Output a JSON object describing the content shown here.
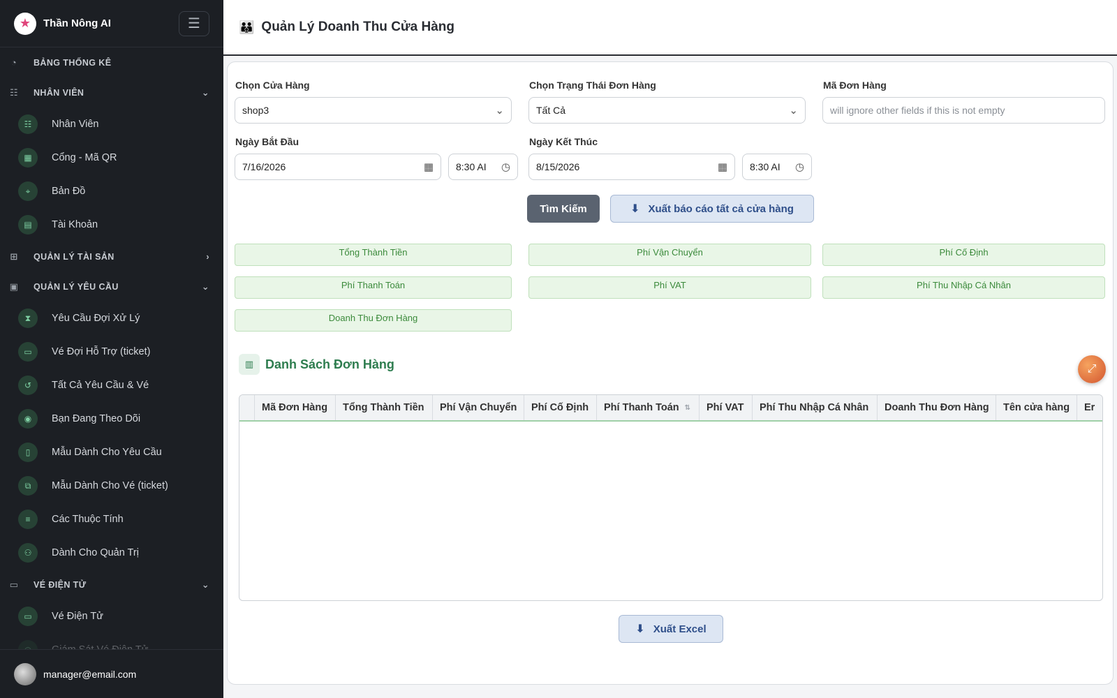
{
  "app": {
    "name": "Thần Nông AI"
  },
  "sidebar": {
    "nav": [
      {
        "type": "section",
        "label": "BẢNG THỐNG KÊ",
        "icon": "dashboard-icon",
        "glyph": "◔",
        "chevron": ""
      },
      {
        "type": "section",
        "label": "NHÂN VIÊN",
        "icon": "users-icon",
        "glyph": "☷",
        "chevron": "⌄"
      },
      {
        "type": "item",
        "label": "Nhân Viên",
        "icon": "users-icon",
        "glyph": "☷"
      },
      {
        "type": "item",
        "label": "Cổng - Mã QR",
        "icon": "qr-code-icon",
        "glyph": "▦"
      },
      {
        "type": "item",
        "label": "Bản Đồ",
        "icon": "map-icon",
        "glyph": "⌖"
      },
      {
        "type": "item",
        "label": "Tài Khoản",
        "icon": "id-card-icon",
        "glyph": "▤"
      },
      {
        "type": "section",
        "label": "QUẢN LÝ TÀI SẢN",
        "icon": "sitemap-icon",
        "glyph": "⊞",
        "chevron": "›"
      },
      {
        "type": "section",
        "label": "QUẢN LÝ YÊU CẦU",
        "icon": "clipboard-icon",
        "glyph": "▣",
        "chevron": "⌄"
      },
      {
        "type": "item",
        "label": "Yêu Cầu Đợi Xử Lý",
        "icon": "hourglass-icon",
        "glyph": "⧗"
      },
      {
        "type": "item",
        "label": "Vé Đợi Hỗ Trợ (ticket)",
        "icon": "ticket-icon",
        "glyph": "▭"
      },
      {
        "type": "item",
        "label": "Tất Cả Yêu Cầu & Vé",
        "icon": "history-icon",
        "glyph": "↺"
      },
      {
        "type": "item",
        "label": "Bạn Đang Theo Dõi",
        "icon": "eye-icon",
        "glyph": "◉"
      },
      {
        "type": "item",
        "label": "Mẫu Dành Cho Yêu Cầu",
        "icon": "file-icon",
        "glyph": "▯"
      },
      {
        "type": "item",
        "label": "Mẫu Dành Cho Vé (ticket)",
        "icon": "copy-icon",
        "glyph": "⧉"
      },
      {
        "type": "item",
        "label": "Các Thuộc Tính",
        "icon": "sliders-icon",
        "glyph": "≡"
      },
      {
        "type": "item",
        "label": "Dành Cho Quản Trị",
        "icon": "user-gear-icon",
        "glyph": "⚇"
      },
      {
        "type": "section",
        "label": "VÉ ĐIỆN TỬ",
        "icon": "ticket-icon",
        "glyph": "▭",
        "chevron": "⌄"
      },
      {
        "type": "item",
        "label": "Vé Điện Tử",
        "icon": "ticket-icon",
        "glyph": "▭"
      },
      {
        "type": "item",
        "label": "Giám Sát Vé Điện Tử",
        "icon": "monitor-icon",
        "glyph": "◎",
        "faded": true
      }
    ],
    "user_email": "manager@email.com"
  },
  "header": {
    "title": "Quản Lý Doanh Thu Cửa Hàng",
    "icon": "people-icon"
  },
  "filters": {
    "store_label": "Chọn Cửa Hàng",
    "store_value": "shop3",
    "status_label": "Chọn Trạng Thái Đơn Hàng",
    "status_value": "Tất Cả",
    "order_id_label": "Mã Đơn Hàng",
    "order_id_placeholder": "will ignore other fields if this is not empty",
    "start_label": "Ngày Bắt Đầu",
    "start_date": "7/16/2026",
    "start_time": "8:30 AI",
    "end_label": "Ngày Kết Thúc",
    "end_date": "8/15/2026",
    "end_time": "8:30 AI"
  },
  "actions": {
    "search_label": "Tìm Kiếm",
    "export_all_label": "Xuất báo cáo tất cả cửa hàng",
    "export_excel_label": "Xuất Excel"
  },
  "summary": {
    "total": "Tổng Thành Tiền",
    "shipping": "Phí Vận Chuyển",
    "fixed": "Phí Cố Định",
    "payment": "Phí Thanh Toán",
    "vat": "Phí VAT",
    "pit": "Phí Thu Nhập Cá Nhân",
    "revenue": "Doanh Thu Đơn Hàng"
  },
  "orders": {
    "title": "Danh Sách Đơn Hàng",
    "columns": [
      "Mã Đơn Hàng",
      "Tổng Thành Tiền",
      "Phí Vận Chuyển",
      "Phí Cố Định",
      "Phí Thanh Toán",
      "Phí VAT",
      "Phí Thu Nhập Cá Nhân",
      "Doanh Thu Đơn Hàng",
      "Tên cửa hàng",
      "Er"
    ],
    "rows": []
  }
}
